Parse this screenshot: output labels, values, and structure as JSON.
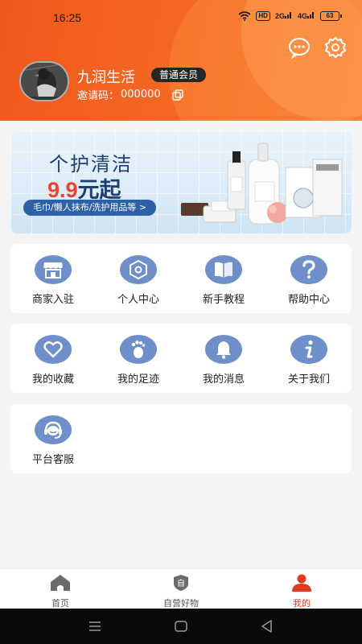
{
  "status_bar": {
    "time": "16:25",
    "hd_label": "HD",
    "sim1_label": "2G",
    "sim2_label": "4G",
    "battery": "63"
  },
  "header": {
    "user_name": "九润生活",
    "member_level": "普通会员",
    "invite_label": "邀请码：",
    "invite_code": "000000",
    "bg_color": "#f0581c"
  },
  "banner": {
    "title": "个护清洁",
    "price_number": "9.9",
    "price_unit": "元起",
    "categories": "毛巾/懒人抹布/洗护用品等 >"
  },
  "menu_rows": [
    [
      {
        "label": "商家入驻",
        "icon": "store-icon"
      },
      {
        "label": "个人中心",
        "icon": "user-hexagon-icon"
      },
      {
        "label": "新手教程",
        "icon": "book-icon"
      },
      {
        "label": "帮助中心",
        "icon": "question-icon"
      }
    ],
    [
      {
        "label": "我的收藏",
        "icon": "heart-icon"
      },
      {
        "label": "我的足迹",
        "icon": "footprint-icon"
      },
      {
        "label": "我的消息",
        "icon": "bell-icon"
      },
      {
        "label": "关于我们",
        "icon": "info-icon"
      }
    ],
    [
      {
        "label": "平台客服",
        "icon": "headset-icon"
      }
    ]
  ],
  "tabs": [
    {
      "label": "首页",
      "icon": "home-icon",
      "active": false
    },
    {
      "label": "自营好物",
      "icon": "self-shop-icon",
      "active": false
    },
    {
      "label": "我的",
      "icon": "profile-icon",
      "active": true
    }
  ],
  "colors": {
    "accent": "#e23a1d",
    "icon_bg": "#6e8fc9",
    "banner_blue": "#1d3f74"
  }
}
